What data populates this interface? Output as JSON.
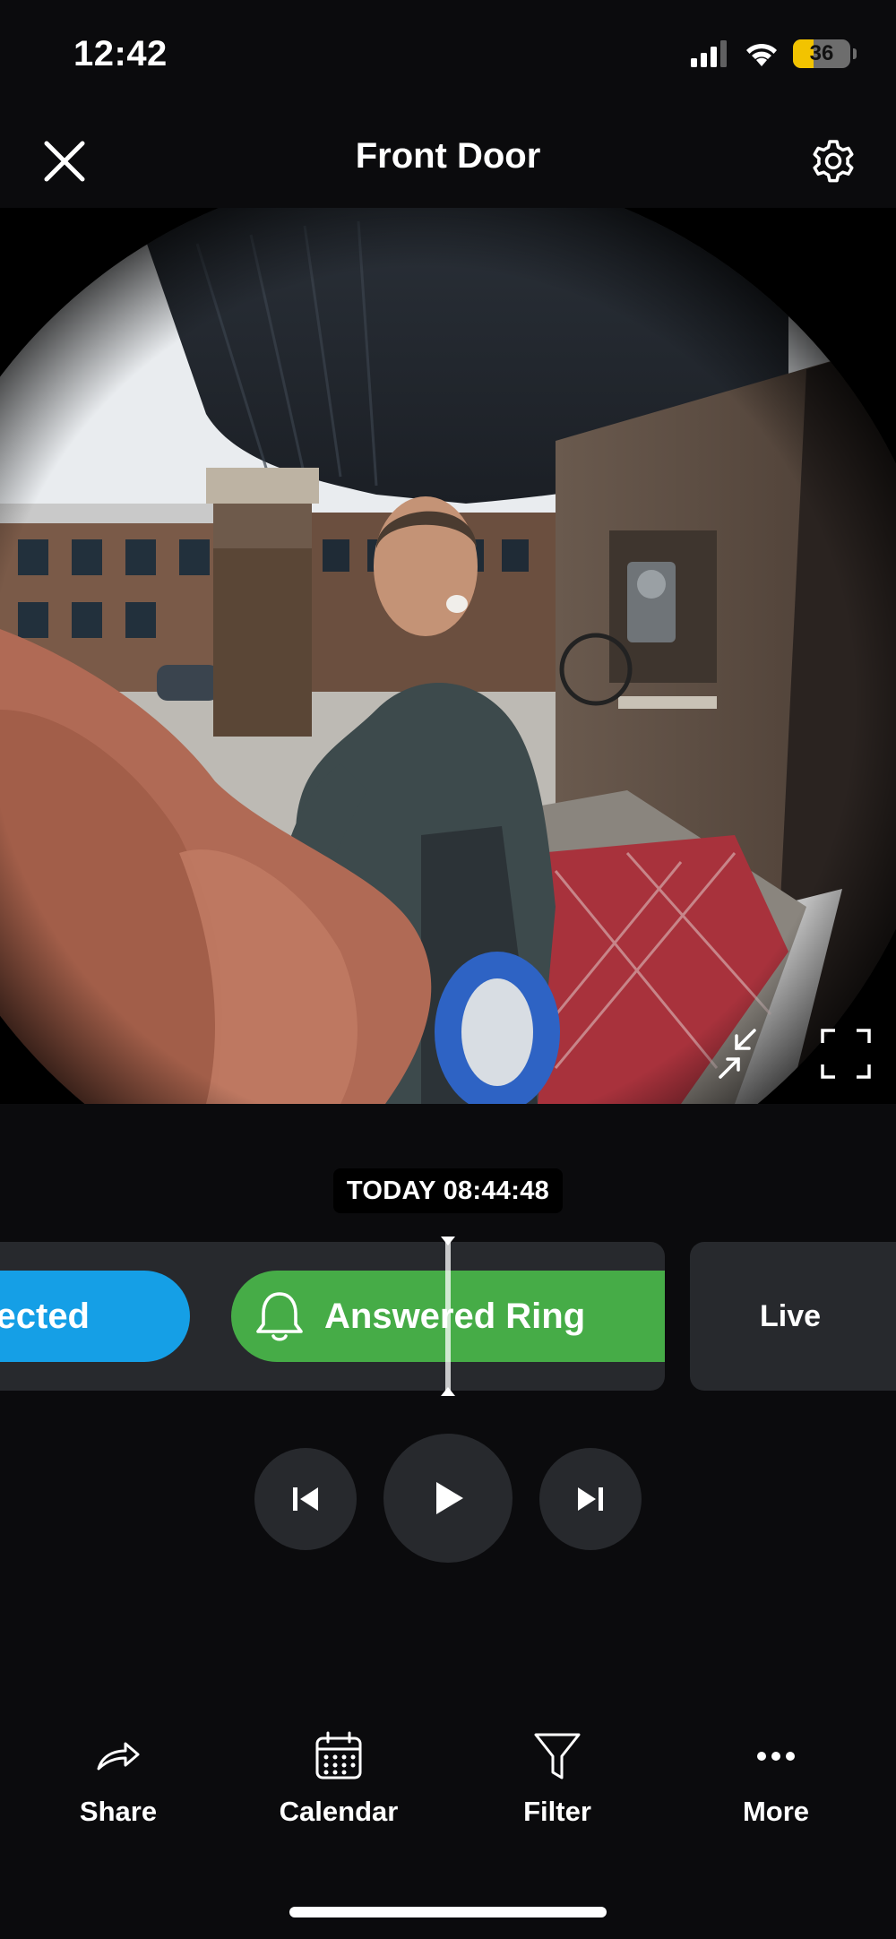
{
  "status_bar": {
    "time": "12:42",
    "battery_percent": "36",
    "battery_level": 0.36,
    "battery_color": "#f2c300",
    "icons": [
      "signal-icon",
      "wifi-icon",
      "battery-icon"
    ]
  },
  "header": {
    "title": "Front Door",
    "close_icon": "close-icon",
    "settings_icon": "gear-icon"
  },
  "video": {
    "overlay_icons": [
      "minimize-icon",
      "fullscreen-icon"
    ]
  },
  "timeline": {
    "timestamp": "TODAY 08:44:48",
    "events": [
      {
        "label": "ected",
        "color": "#159fe6"
      },
      {
        "label": "Answered Ring",
        "icon": "bell-icon",
        "color": "#46ac47"
      }
    ],
    "live_label": "Live"
  },
  "playback": {
    "prev_icon": "skip-previous-icon",
    "play_icon": "play-icon",
    "next_icon": "skip-next-icon"
  },
  "bottom_nav": {
    "items": [
      {
        "label": "Share",
        "icon": "share-icon"
      },
      {
        "label": "Calendar",
        "icon": "calendar-icon"
      },
      {
        "label": "Filter",
        "icon": "filter-icon"
      },
      {
        "label": "More",
        "icon": "more-icon"
      }
    ]
  }
}
